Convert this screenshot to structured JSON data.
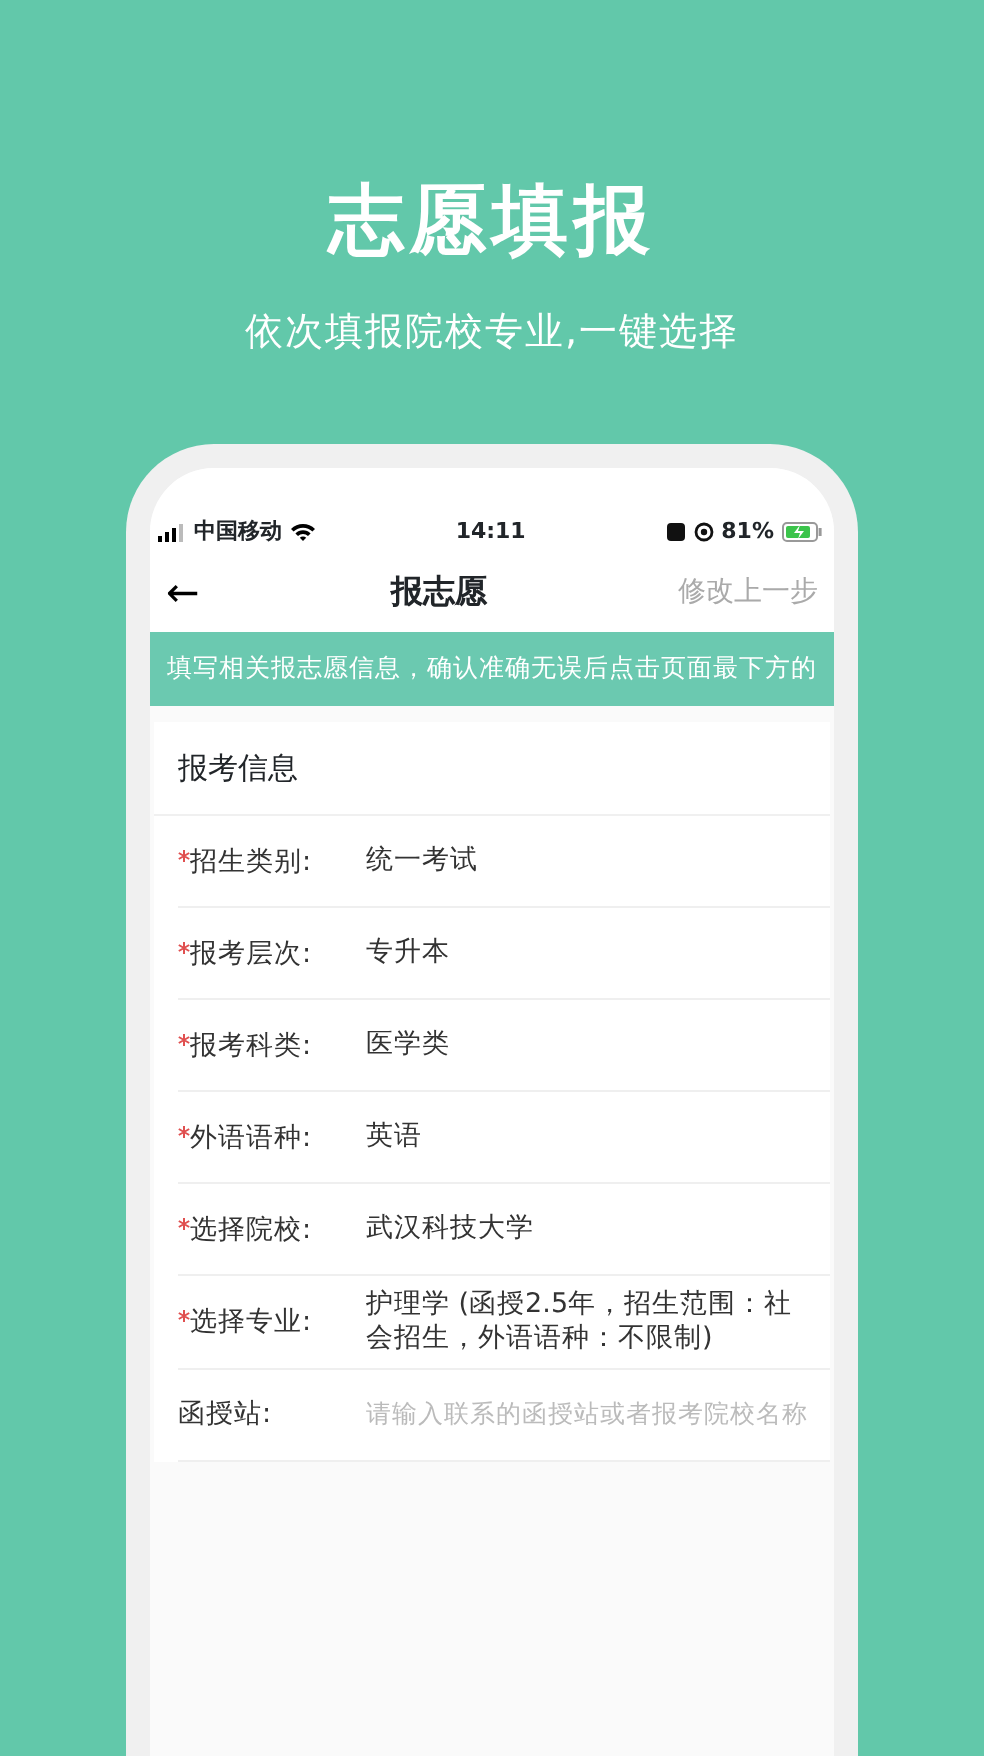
{
  "headline": "志愿填报",
  "subtitle": "依次填报院校专业,一键选择",
  "status_bar": {
    "carrier": "中国移动",
    "time": "14:11",
    "battery": "81%"
  },
  "nav": {
    "back": "←",
    "title": "报志愿",
    "action": "修改上一步"
  },
  "notice": "填写相关报志愿信息，确认准确无误后点击页面最下方的",
  "section_title": "报考信息",
  "fields": [
    {
      "label": "招生类别:",
      "required": true,
      "kind": "value",
      "value": "统一考试"
    },
    {
      "label": "报考层次:",
      "required": true,
      "kind": "value",
      "value": "专升本"
    },
    {
      "label": "报考科类:",
      "required": true,
      "kind": "value",
      "value": "医学类"
    },
    {
      "label": "外语语种:",
      "required": true,
      "kind": "value",
      "value": "英语"
    },
    {
      "label": "选择院校:",
      "required": true,
      "kind": "value",
      "value": "武汉科技大学"
    },
    {
      "label": "选择专业:",
      "required": true,
      "kind": "value",
      "value": "护理学 (函授2.5年，招生范围：社会招生，外语语种：不限制)"
    },
    {
      "label": "函授站:",
      "required": false,
      "kind": "input",
      "placeholder": "请输入联系的函授站或者报考院校名称"
    }
  ]
}
